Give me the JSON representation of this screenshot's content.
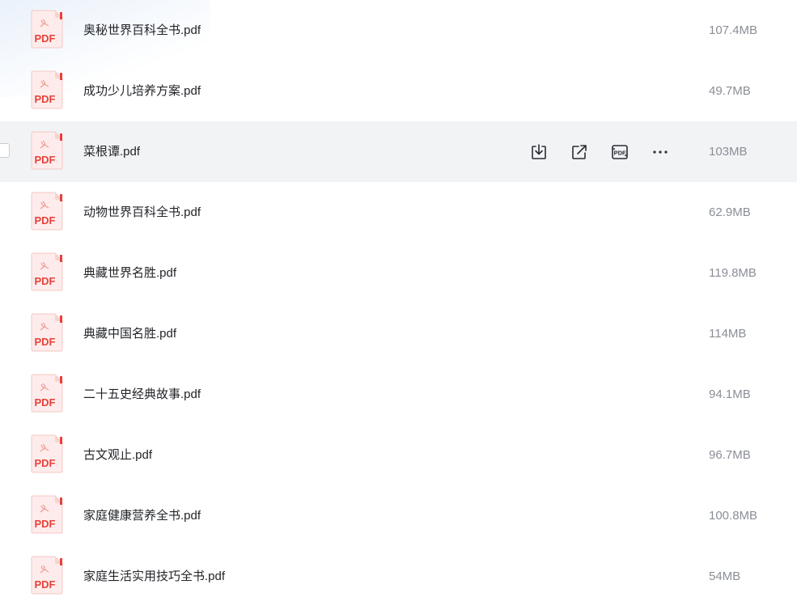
{
  "icons": {
    "file_type": "pdf-file-icon",
    "file_badge_text": "PDF",
    "actions": [
      "download-icon",
      "share-icon",
      "convert-pdf-icon",
      "more-icon"
    ]
  },
  "colors": {
    "pdf_red": "#e8413a",
    "hover_row": "#f2f3f5",
    "name_text": "#222428",
    "size_text": "#8a8e96"
  },
  "files": [
    {
      "name": "奥秘世界百科全书.pdf",
      "size": "107.4MB"
    },
    {
      "name": "成功少儿培养方案.pdf",
      "size": "49.7MB"
    },
    {
      "name": "菜根谭.pdf",
      "size": "103MB"
    },
    {
      "name": "动物世界百科全书.pdf",
      "size": "62.9MB"
    },
    {
      "name": "典藏世界名胜.pdf",
      "size": "119.8MB"
    },
    {
      "name": "典藏中国名胜.pdf",
      "size": "114MB"
    },
    {
      "name": "二十五史经典故事.pdf",
      "size": "94.1MB"
    },
    {
      "name": "古文观止.pdf",
      "size": "96.7MB"
    },
    {
      "name": "家庭健康营养全书.pdf",
      "size": "100.8MB"
    },
    {
      "name": "家庭生活实用技巧全书.pdf",
      "size": "54MB"
    }
  ]
}
